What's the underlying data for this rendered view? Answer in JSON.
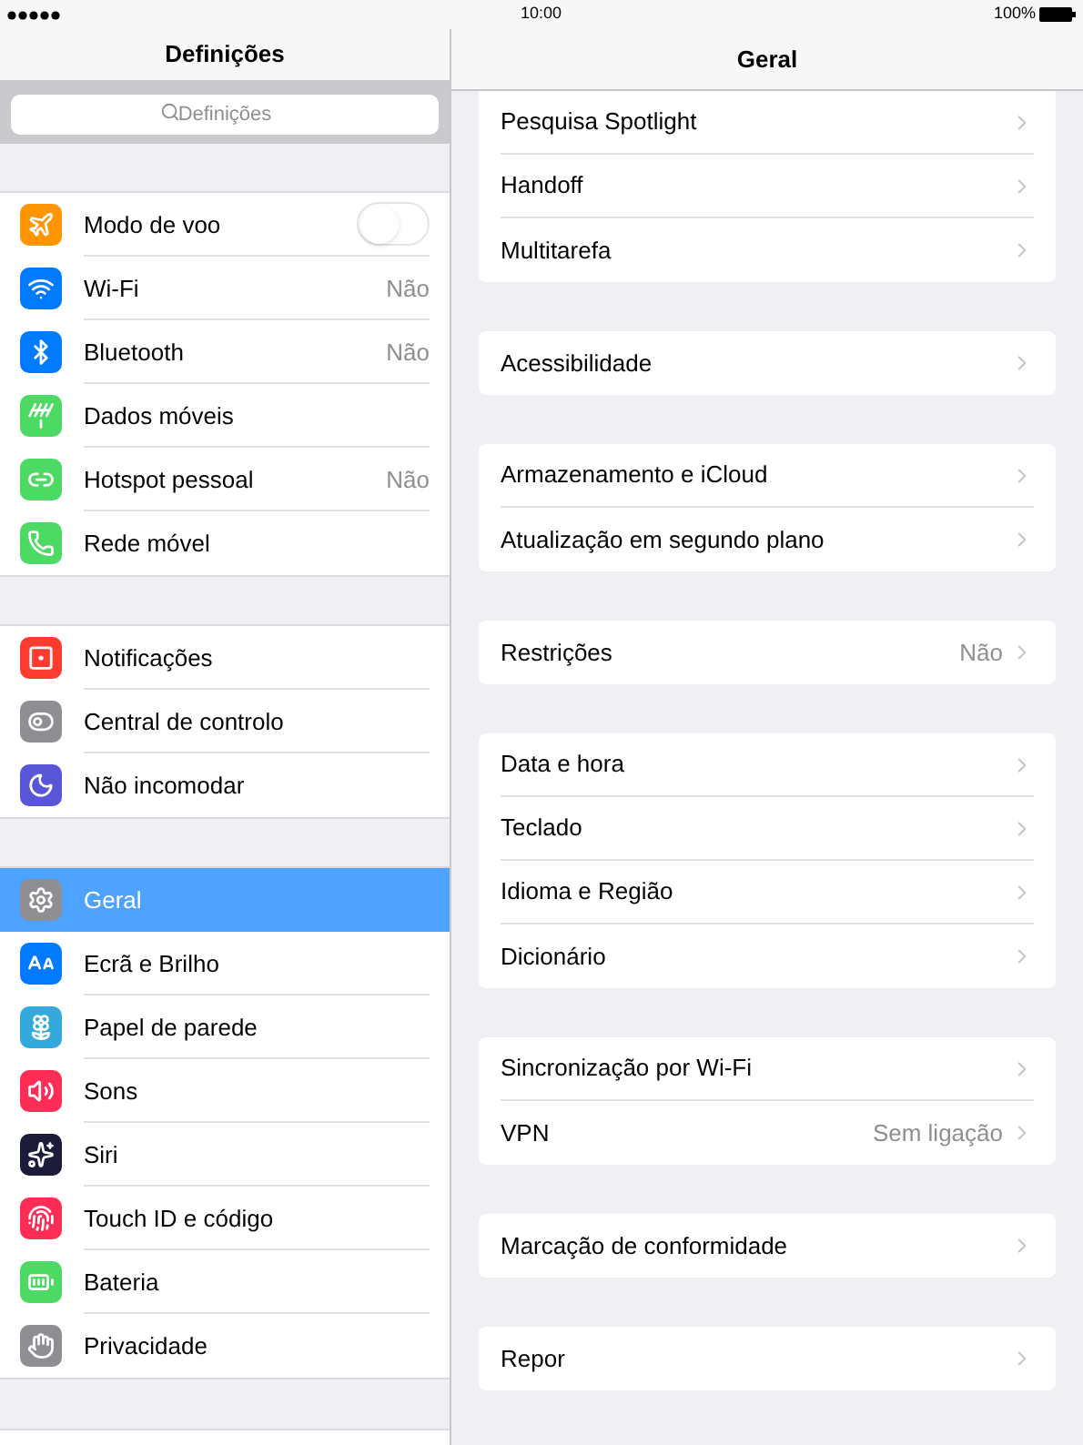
{
  "status_bar": {
    "time": "10:00",
    "battery": "100%"
  },
  "sidebar": {
    "title": "Definições",
    "search": {
      "placeholder": "Definições"
    },
    "groups": [
      {
        "items": [
          {
            "label": "Modo de voo",
            "kind": "toggle",
            "on": false,
            "selected": false
          },
          {
            "label": "Wi-Fi",
            "value": "Não",
            "kind": "link",
            "selected": false
          },
          {
            "label": "Bluetooth",
            "value": "Não",
            "kind": "link",
            "selected": false
          },
          {
            "label": "Dados móveis",
            "kind": "link",
            "selected": false
          },
          {
            "label": "Hotspot pessoal",
            "value": "Não",
            "kind": "link",
            "selected": false
          },
          {
            "label": "Rede móvel",
            "kind": "link",
            "selected": false
          }
        ]
      },
      {
        "items": [
          {
            "label": "Notificações",
            "kind": "link",
            "selected": false
          },
          {
            "label": "Central de controlo",
            "kind": "link",
            "selected": false
          },
          {
            "label": "Não incomodar",
            "kind": "link",
            "selected": false
          }
        ]
      },
      {
        "items": [
          {
            "label": "Geral",
            "kind": "link",
            "selected": true
          },
          {
            "label": "Ecrã e Brilho",
            "kind": "link",
            "selected": false
          },
          {
            "label": "Papel de parede",
            "kind": "link",
            "selected": false
          },
          {
            "label": "Sons",
            "kind": "link",
            "selected": false
          },
          {
            "label": "Siri",
            "kind": "link",
            "selected": false
          },
          {
            "label": "Touch ID e código",
            "kind": "link",
            "selected": false
          },
          {
            "label": "Bateria",
            "kind": "link",
            "selected": false
          },
          {
            "label": "Privacidade",
            "kind": "link",
            "selected": false
          }
        ]
      }
    ]
  },
  "detail": {
    "title": "Geral",
    "groups": [
      {
        "items": [
          {
            "label": "Pesquisa Spotlight"
          },
          {
            "label": "Handoff"
          },
          {
            "label": "Multitarefa"
          }
        ]
      },
      {
        "items": [
          {
            "label": "Acessibilidade"
          }
        ]
      },
      {
        "items": [
          {
            "label": "Armazenamento e iCloud"
          },
          {
            "label": "Atualização em segundo plano"
          }
        ]
      },
      {
        "items": [
          {
            "label": "Restrições",
            "value": "Não"
          }
        ]
      },
      {
        "items": [
          {
            "label": "Data e hora"
          },
          {
            "label": "Teclado"
          },
          {
            "label": "Idioma e Região"
          },
          {
            "label": "Dicionário"
          }
        ]
      },
      {
        "items": [
          {
            "label": "Sincronização por Wi-Fi"
          },
          {
            "label": "VPN",
            "value": "Sem ligação"
          }
        ]
      },
      {
        "items": [
          {
            "label": "Marcação de conformidade"
          }
        ]
      },
      {
        "items": [
          {
            "label": "Repor"
          }
        ]
      }
    ]
  }
}
